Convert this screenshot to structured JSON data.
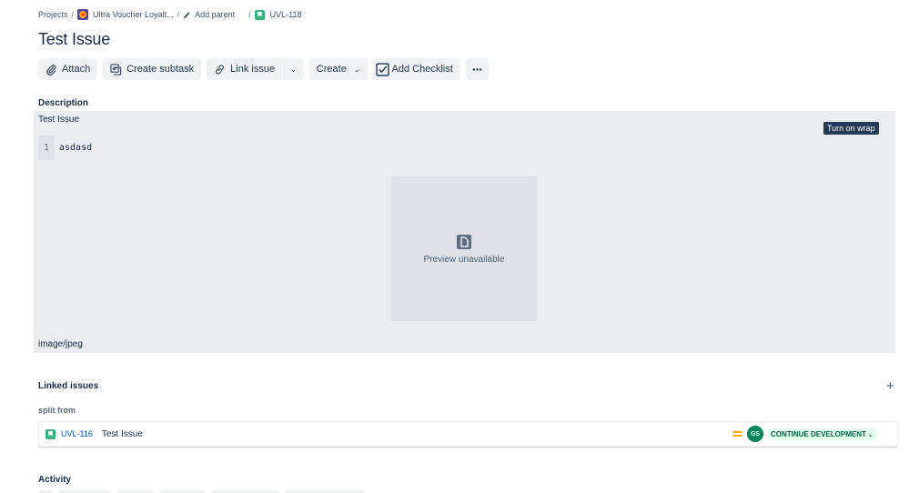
{
  "breadcrumb": {
    "projects": "Projects",
    "project_name": "Ultra Voucher Loyalt...",
    "add_parent": "Add parent",
    "issue_key": "UVL-118",
    "separator": "/"
  },
  "issue": {
    "title": "Test Issue"
  },
  "toolbar": {
    "attach": "Attach",
    "create_subtask": "Create subtask",
    "link_issue": "Link issue",
    "create": "Create",
    "add_checklist": "Add Checklist"
  },
  "description": {
    "heading": "Description",
    "text": "Test Issue",
    "wrap_button": "Turn on wrap",
    "code_line_number": "1",
    "code_text": "asdasd",
    "preview_text": "Preview unavailable",
    "mime_type": "image/jpeg"
  },
  "linked_issues": {
    "heading": "Linked issues",
    "add_symbol": "+",
    "link_type": "split from",
    "items": [
      {
        "key": "UVL-116",
        "summary": "Test Issue",
        "priority": "medium",
        "assignee_initials": "GS",
        "status": "CONTINUE DEVELOPMENT"
      }
    ]
  },
  "activity": {
    "heading": "Activity"
  },
  "colors": {
    "accent": "#0052cc",
    "story": "#36b37e",
    "status_bg": "#e3fcef",
    "status_text": "#006644",
    "assignee_bg": "#00875a",
    "priority": "#ffab00"
  }
}
